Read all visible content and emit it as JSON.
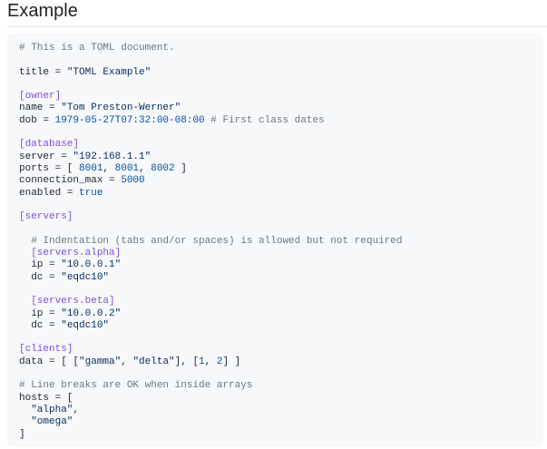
{
  "page": {
    "title": "Example"
  },
  "code": {
    "language": "toml",
    "colors": {
      "comment": "#6e7781",
      "section": "#8250df",
      "string": "#0a3069",
      "number": "#0550ae",
      "plain": "#24292f",
      "background": "#f6f8fa"
    },
    "lines": [
      [
        {
          "t": "# This is a TOML document.",
          "k": "comment"
        }
      ],
      [],
      [
        {
          "t": "title = ",
          "k": "plain"
        },
        {
          "t": "\"TOML Example\"",
          "k": "string"
        }
      ],
      [],
      [
        {
          "t": "[owner]",
          "k": "section"
        }
      ],
      [
        {
          "t": "name = ",
          "k": "plain"
        },
        {
          "t": "\"Tom Preston-Werner\"",
          "k": "string"
        }
      ],
      [
        {
          "t": "dob = ",
          "k": "plain"
        },
        {
          "t": "1979-05-27T07:32:00-08:00",
          "k": "number"
        },
        {
          "t": " # First class dates",
          "k": "comment"
        }
      ],
      [],
      [
        {
          "t": "[database]",
          "k": "section"
        }
      ],
      [
        {
          "t": "server = ",
          "k": "plain"
        },
        {
          "t": "\"192.168.1.1\"",
          "k": "string"
        }
      ],
      [
        {
          "t": "ports = [ ",
          "k": "plain"
        },
        {
          "t": "8001",
          "k": "number"
        },
        {
          "t": ", ",
          "k": "plain"
        },
        {
          "t": "8001",
          "k": "number"
        },
        {
          "t": ", ",
          "k": "plain"
        },
        {
          "t": "8002",
          "k": "number"
        },
        {
          "t": " ]",
          "k": "plain"
        }
      ],
      [
        {
          "t": "connection_max = ",
          "k": "plain"
        },
        {
          "t": "5000",
          "k": "number"
        }
      ],
      [
        {
          "t": "enabled = ",
          "k": "plain"
        },
        {
          "t": "true",
          "k": "number"
        }
      ],
      [],
      [
        {
          "t": "[servers]",
          "k": "section"
        }
      ],
      [],
      [
        {
          "t": "  # Indentation (tabs and/or spaces) is allowed but not required",
          "k": "comment"
        }
      ],
      [
        {
          "t": "  ",
          "k": "plain"
        },
        {
          "t": "[servers.alpha]",
          "k": "section"
        }
      ],
      [
        {
          "t": "  ip = ",
          "k": "plain"
        },
        {
          "t": "\"10.0.0.1\"",
          "k": "string"
        }
      ],
      [
        {
          "t": "  dc = ",
          "k": "plain"
        },
        {
          "t": "\"eqdc10\"",
          "k": "string"
        }
      ],
      [],
      [
        {
          "t": "  ",
          "k": "plain"
        },
        {
          "t": "[servers.beta]",
          "k": "section"
        }
      ],
      [
        {
          "t": "  ip = ",
          "k": "plain"
        },
        {
          "t": "\"10.0.0.2\"",
          "k": "string"
        }
      ],
      [
        {
          "t": "  dc = ",
          "k": "plain"
        },
        {
          "t": "\"eqdc10\"",
          "k": "string"
        }
      ],
      [],
      [
        {
          "t": "[clients]",
          "k": "section"
        }
      ],
      [
        {
          "t": "data = [ [",
          "k": "plain"
        },
        {
          "t": "\"gamma\"",
          "k": "string"
        },
        {
          "t": ", ",
          "k": "plain"
        },
        {
          "t": "\"delta\"",
          "k": "string"
        },
        {
          "t": "], [",
          "k": "plain"
        },
        {
          "t": "1",
          "k": "number"
        },
        {
          "t": ", ",
          "k": "plain"
        },
        {
          "t": "2",
          "k": "number"
        },
        {
          "t": "] ]",
          "k": "plain"
        }
      ],
      [],
      [
        {
          "t": "# Line breaks are OK when inside arrays",
          "k": "comment"
        }
      ],
      [
        {
          "t": "hosts = [",
          "k": "plain"
        }
      ],
      [
        {
          "t": "  ",
          "k": "plain"
        },
        {
          "t": "\"alpha\"",
          "k": "string"
        },
        {
          "t": ",",
          "k": "plain"
        }
      ],
      [
        {
          "t": "  ",
          "k": "plain"
        },
        {
          "t": "\"omega\"",
          "k": "string"
        }
      ],
      [
        {
          "t": "]",
          "k": "plain"
        }
      ]
    ]
  }
}
